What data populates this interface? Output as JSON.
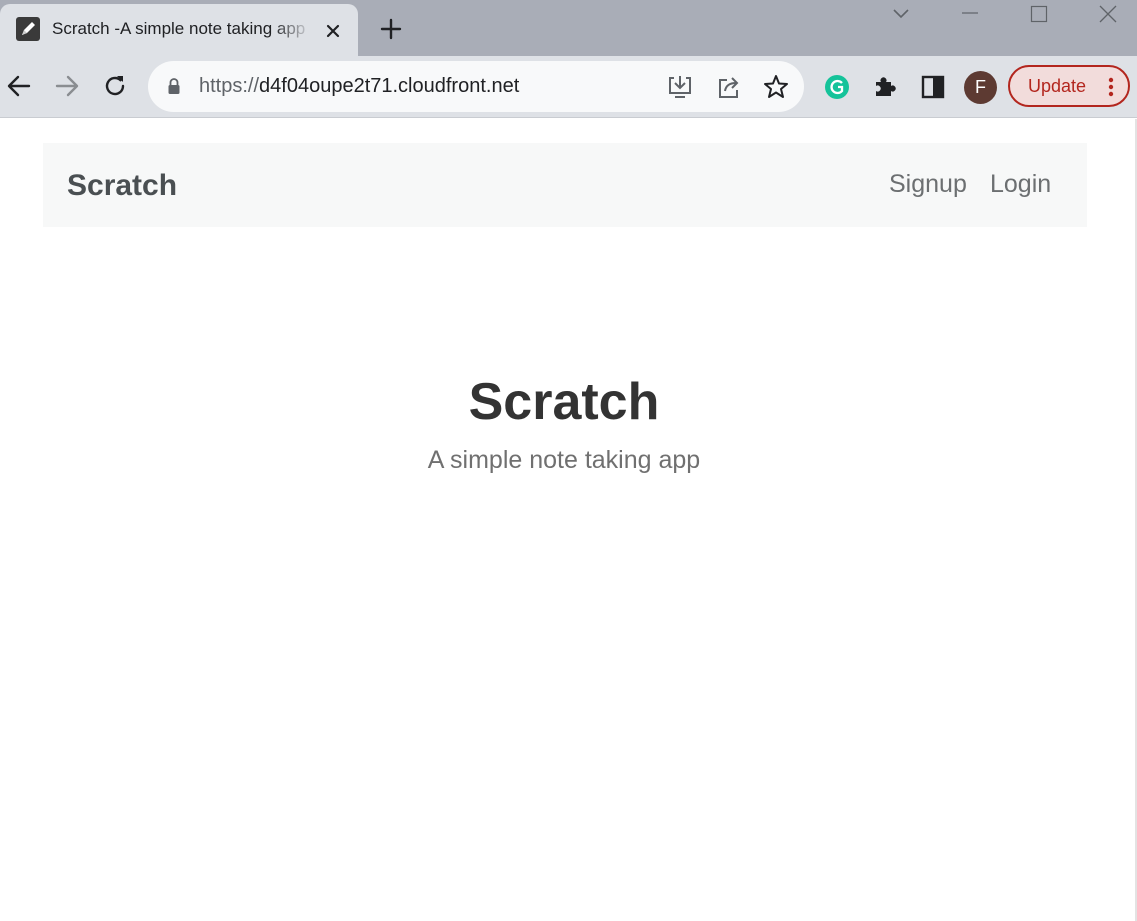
{
  "browser": {
    "tab": {
      "title": "Scratch -A simple note taking app",
      "favicon": "pencil-icon"
    },
    "address_bar": {
      "protocol": "https://",
      "host": "d4f04oupe2t71.cloudfront.net"
    },
    "profile_initial": "F",
    "update_label": "Update",
    "colors": {
      "tabstrip": "#a9adb7",
      "toolbar": "#dee1e6",
      "update_accent": "#b3261e",
      "grammarly": "#15c39a",
      "avatar": "#5d3a32"
    }
  },
  "navbar": {
    "brand": "Scratch",
    "links": [
      {
        "label": "Signup"
      },
      {
        "label": "Login"
      }
    ]
  },
  "hero": {
    "title": "Scratch",
    "subtitle": "A simple note taking app"
  }
}
